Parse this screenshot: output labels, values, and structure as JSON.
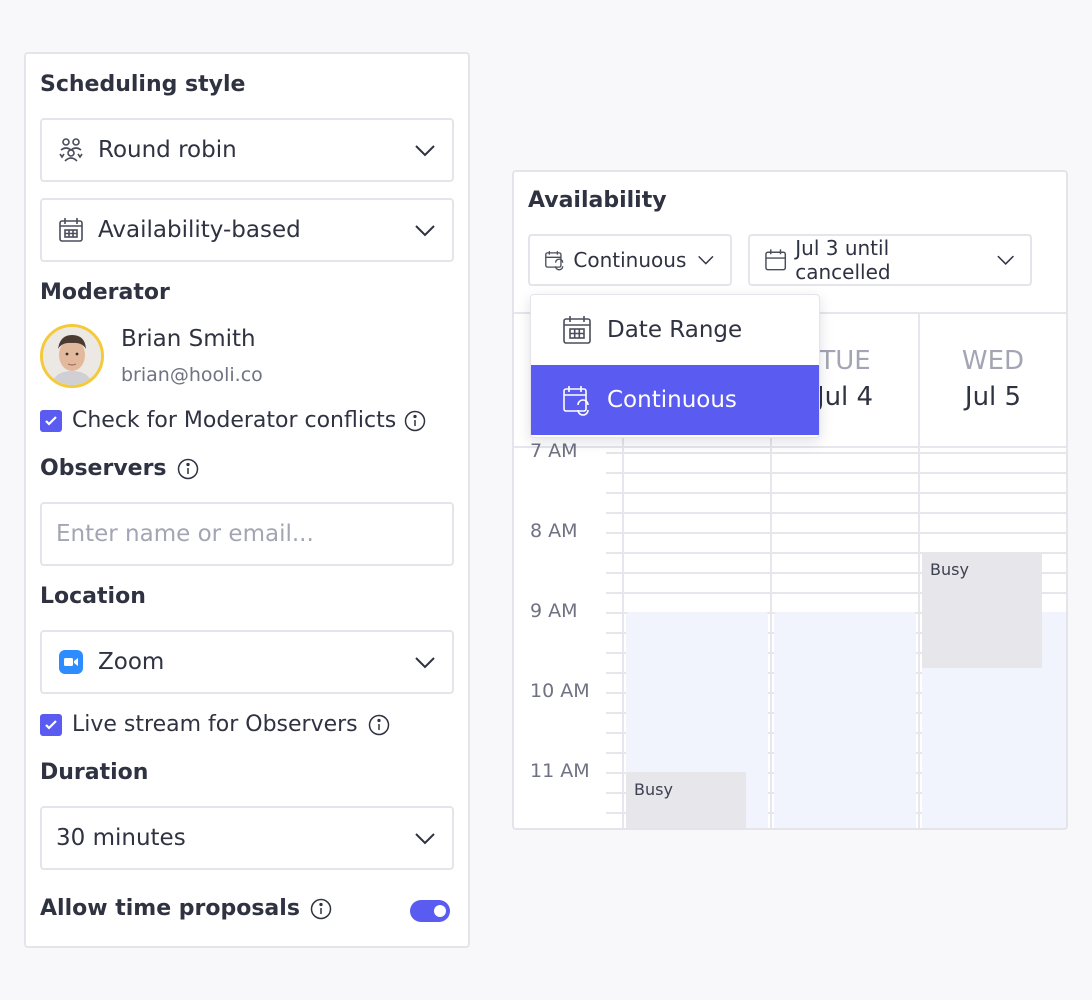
{
  "scheduling": {
    "title": "Scheduling style",
    "style_select": "Round robin",
    "availability_select": "Availability-based"
  },
  "moderator": {
    "title": "Moderator",
    "name": "Brian Smith",
    "email": "brian@hooli.co",
    "conflicts_label": "Check for Moderator conflicts"
  },
  "observers": {
    "title": "Observers",
    "placeholder": "Enter name or email..."
  },
  "location": {
    "title": "Location",
    "value": "Zoom",
    "livestream_label": "Live stream for Observers"
  },
  "duration": {
    "title": "Duration",
    "value": "30 minutes"
  },
  "proposals": {
    "label": "Allow time proposals",
    "enabled": true
  },
  "availability": {
    "title": "Availability",
    "mode": "Continuous",
    "range": "Jul 3 until cancelled",
    "dropdown": [
      {
        "label": "Date Range",
        "selected": false
      },
      {
        "label": "Continuous",
        "selected": true
      }
    ],
    "days": [
      {
        "name": "TUE",
        "date": "Jul 4"
      },
      {
        "name": "WED",
        "date": "Jul 5"
      }
    ],
    "times": [
      "7 AM",
      "8 AM",
      "9 AM",
      "10 AM",
      "11 AM"
    ],
    "busy_label": "Busy",
    "busy_label_2": "Busy"
  },
  "colors": {
    "accent": "#5a5bf0",
    "avatar_ring": "#f4c93a",
    "zoom": "#2d8cff"
  }
}
